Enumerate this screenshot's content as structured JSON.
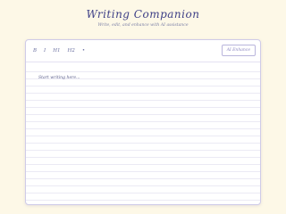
{
  "header": {
    "title": "Writing Companion",
    "subtitle": "Write, edit, and enhance with AI assistance"
  },
  "toolbar": {
    "bold_label": "B",
    "italic_label": "I",
    "h1_label": "H1",
    "h2_label": "H2",
    "bullet_label": "•",
    "ai_button_label": "AI Enhance"
  },
  "editor": {
    "placeholder": "Start writing here..."
  },
  "colors": {
    "background": "#fdf8e7",
    "accent": "#3d3f86",
    "border": "#cfcbe8"
  }
}
